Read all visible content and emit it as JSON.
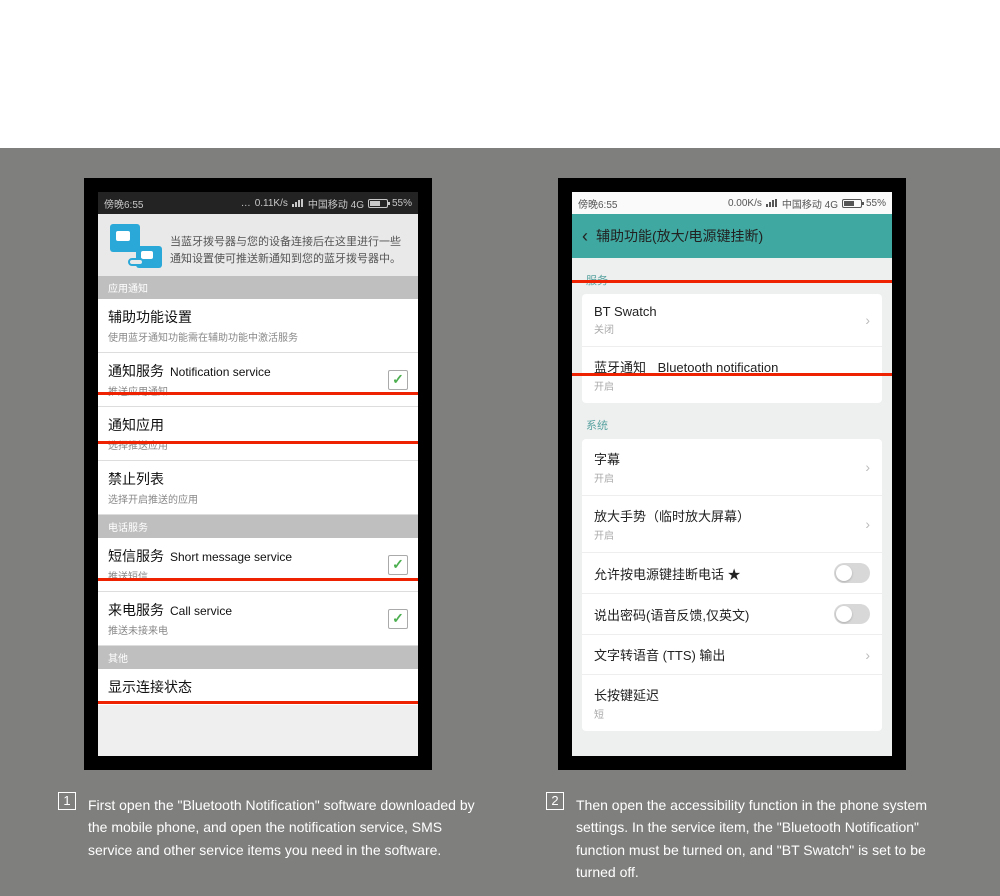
{
  "statusbar": {
    "time": "傍晚6:55",
    "speed1": "0.11K/s",
    "speed2": "0.00K/s",
    "carrier": "中国移动 4G",
    "battery": "55%"
  },
  "screen1": {
    "intro": "当蓝牙拨号器与您的设备连接后在这里进行一些通知设置使可推送新通知到您的蓝牙拨号器中。",
    "sec_app": "应用通知",
    "rows": {
      "accessibility": {
        "title": "辅助功能设置",
        "sub": "使用蓝牙通知功能需在辅助功能中激活服务"
      },
      "notif": {
        "title": "通知服务",
        "en": "Notification service",
        "sub": "推送应用通知"
      },
      "notifapp": {
        "title": "通知应用",
        "sub": "选择推送应用"
      },
      "block": {
        "title": "禁止列表",
        "sub": "选择开启推送的应用"
      }
    },
    "sec_phone": "电话服务",
    "rows2": {
      "sms": {
        "title": "短信服务",
        "en": "Short message service",
        "sub": "推送短信"
      },
      "call": {
        "title": "来电服务",
        "en": "Call service",
        "sub": "推送未接来电"
      }
    },
    "sec_other": "其他",
    "cut": "显示连接状态"
  },
  "screen2": {
    "title": "辅助功能(放大/电源键挂断)",
    "lbl_service": "服务",
    "service": {
      "bt": {
        "title": "BT Swatch",
        "sub": "关闭"
      },
      "btn": {
        "title": "蓝牙通知",
        "tr": "Bluetooth notification",
        "sub": "开启"
      }
    },
    "lbl_system": "系统",
    "system": {
      "sub1": {
        "title": "字幕",
        "sub": "开启"
      },
      "mag": {
        "title": "放大手势（临时放大屏幕）",
        "sub": "开启"
      },
      "pwr": {
        "title": "允许按电源键挂断电话 ★"
      },
      "pwd": {
        "title": "说出密码(语音反馈,仅英文)"
      },
      "tts": {
        "title": "文字转语音 (TTS) 输出"
      },
      "long": {
        "title": "长按键延迟",
        "sub": "短"
      }
    }
  },
  "captions": {
    "n1": "1",
    "c1": "First open the \"Bluetooth Notification\" software downloaded by the mobile phone, and open the notification service, SMS service and other service items you need in the software.",
    "n2": "2",
    "c2": "Then open the accessibility function in the phone system settings. In the service item, the \"Bluetooth Notification\" function must be turned on, and \"BT Swatch\" is set to be turned off."
  }
}
